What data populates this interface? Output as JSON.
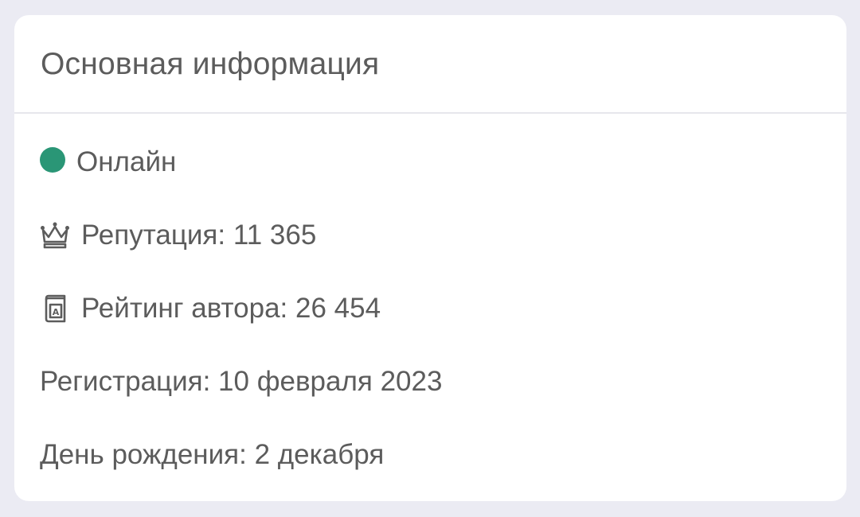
{
  "card": {
    "title": "Основная информация",
    "status": {
      "label": "Онлайн",
      "color": "#2a9676"
    },
    "reputation": {
      "icon": "crown-icon",
      "text": "Репутация: 11 365"
    },
    "author_rating": {
      "icon": "book-icon",
      "text": "Рейтинг автора: 26 454"
    },
    "registration": {
      "text": "Регистрация: 10 февраля 2023"
    },
    "birthday": {
      "text": "День рождения: 2 декабря"
    }
  },
  "colors": {
    "background": "#ebebf3",
    "card": "#ffffff",
    "text": "#5c5c5c",
    "divider": "#e6e6ec"
  }
}
